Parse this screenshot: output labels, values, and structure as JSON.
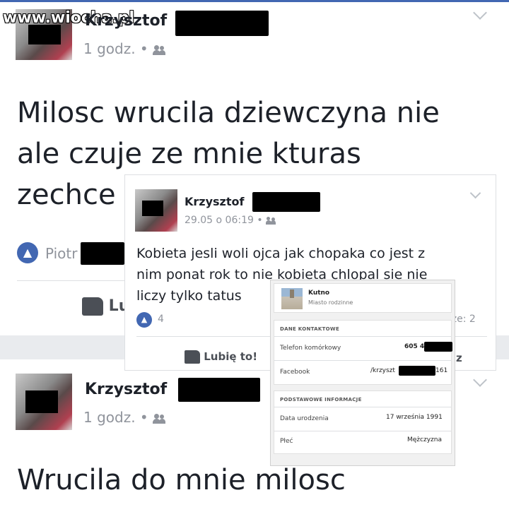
{
  "watermark": "www.wiocha.pl",
  "post1": {
    "author": "Krzysztof",
    "time": "1 godz. •",
    "text_lines": [
      "Milosc wrucila dziewczyna nie",
      "ale czuje ze mnie kturas",
      "zechce"
    ],
    "liker": "Piotr",
    "like_label": "Lu"
  },
  "overlay": {
    "author": "Krzysztof",
    "time": "29.05 o 06:19 •",
    "text_lines": [
      "Kobieta jesli woli ojca jak chopaka co jest z",
      "nim ponat rok to nie kobieta chlopal sie nie",
      "liczy tylko tatus"
    ],
    "like_count": "4",
    "like_label": "Lubię to!",
    "side_fragment": "z",
    "shares_fragment": "rze: 2"
  },
  "profile_card": {
    "city": "Kutno",
    "city_sub": "Miasto rodzinne",
    "contact_header": "DANE KONTAKTOWE",
    "phone_label": "Telefon komórkowy",
    "phone_value": "605 4",
    "fb_label": "Facebook",
    "fb_value": "/krzyszt",
    "fb_value_end": "161",
    "basic_header": "PODSTAWOWE INFORMACJE",
    "birth_label": "Data urodzenia",
    "birth_value": "17 września 1991",
    "gender_label": "Płeć",
    "gender_value": "Mężczyzna"
  },
  "post2": {
    "author": "Krzysztof",
    "time": "1 godz. •",
    "text_line": "Wrucila do mnie milosc"
  },
  "colors": {
    "accent": "#4267b2",
    "text": "#1d2129",
    "meta": "#90949c"
  }
}
